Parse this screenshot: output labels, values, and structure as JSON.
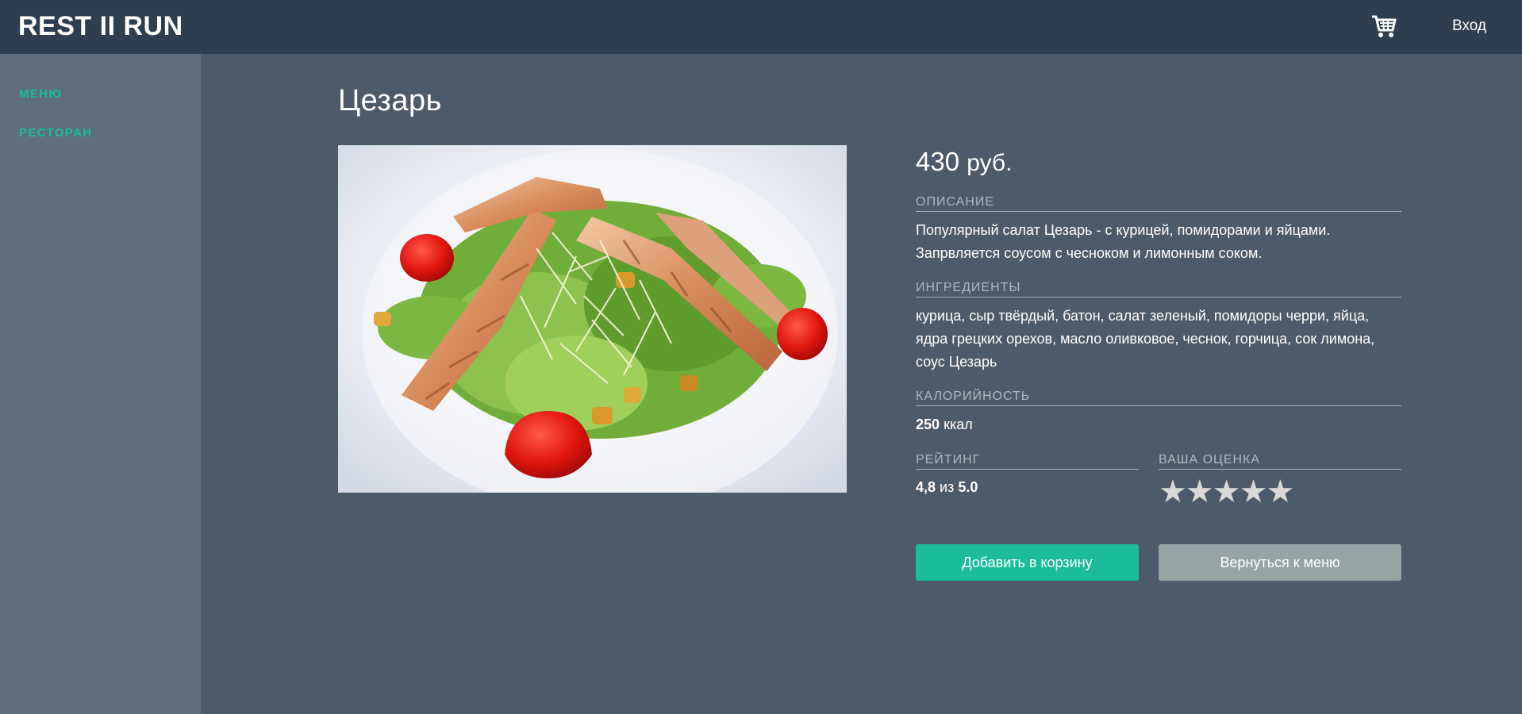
{
  "header": {
    "brand": "REST II RUN",
    "cart_icon": "cart-icon",
    "login_label": "Вход"
  },
  "sidebar": {
    "items": [
      {
        "label": "МЕНЮ"
      },
      {
        "label": "РЕСТОРАН"
      }
    ]
  },
  "dish": {
    "title": "Цезарь",
    "price_value": "430",
    "price_unit": "руб.",
    "description_label": "ОПИСАНИЕ",
    "description_lines": [
      "Популярный салат Цезарь - с курицей, помидорами и яйцами.",
      "Запрвляется соусом с чесноком и лимонным соком."
    ],
    "ingredients_label": "ИНГРЕДИЕНТЫ",
    "ingredients_lines": [
      "курица, сыр твёрдый, батон, салат зеленый, помидоры черри, яйца,",
      "ядра грецких орехов, масло оливковое, чеснок, горчица, сок лимона,",
      "соус Цезарь"
    ],
    "calories_label": "КАЛОРИЙНОСТЬ",
    "calories_value": "250",
    "calories_unit": "ккал",
    "rating_label": "РЕЙТИНГ",
    "rating_value": "4,8",
    "rating_of": "из",
    "rating_max": "5.0",
    "your_rating_label": "ВАША ОЦЕНКА",
    "your_rating_stars": 0,
    "star_count": 5,
    "star_glyph": "★"
  },
  "buttons": {
    "add_to_cart": "Добавить в корзину",
    "back_to_menu": "Вернуться к меню"
  },
  "colors": {
    "accent": "#1abc9c",
    "header_bg": "#2c3e50",
    "sidebar_bg": "#5e6e7e",
    "content_bg": "#4c5b6b",
    "secondary_button": "#95a5a6"
  }
}
